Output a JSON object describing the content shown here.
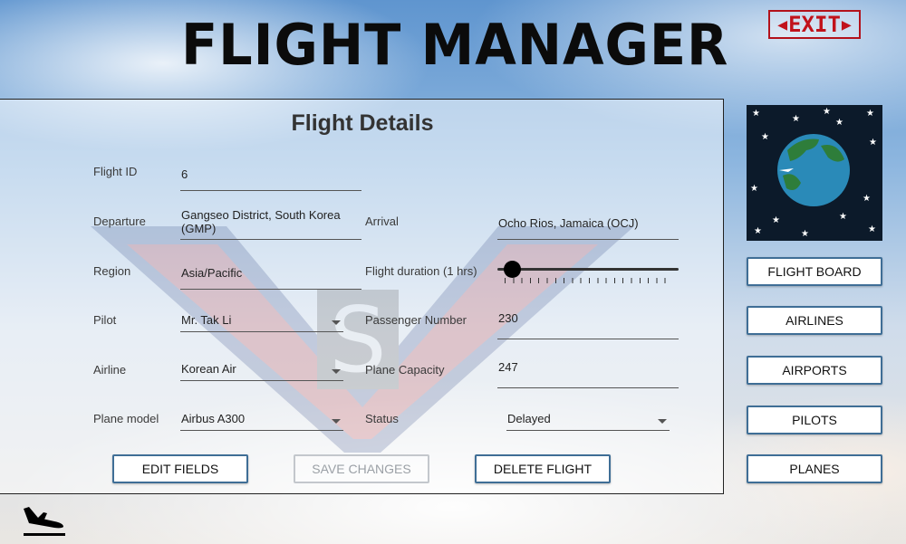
{
  "app": {
    "title": "FLIGHT MANAGER",
    "exit_label": "EXIT"
  },
  "form": {
    "title": "Flight Details",
    "flight_id": {
      "label": "Flight ID",
      "value": "6"
    },
    "departure": {
      "label": "Departure",
      "value": "Gangseo District, South Korea (GMP)"
    },
    "arrival": {
      "label": "Arrival",
      "value": "Ocho Rios, Jamaica (OCJ)"
    },
    "region": {
      "label": "Region",
      "value": "Asia/Pacific"
    },
    "duration": {
      "label": "Flight duration (1 hrs)",
      "value_hrs": 1
    },
    "pilot": {
      "label": "Pilot",
      "value": "Mr. Tak Li"
    },
    "passengers": {
      "label": "Passenger Number",
      "value": "230"
    },
    "airline": {
      "label": "Airline",
      "value": "Korean Air"
    },
    "capacity": {
      "label": "Plane Capacity",
      "value": "247"
    },
    "plane_model": {
      "label": "Plane model",
      "value": "Airbus A300"
    },
    "status": {
      "label": "Status",
      "value": "Delayed"
    }
  },
  "actions": {
    "edit": "EDIT FIELDS",
    "save": "SAVE CHANGES",
    "delete": "DELETE FLIGHT"
  },
  "nav": {
    "flight_board": "FLIGHT BOARD",
    "airlines": "AIRLINES",
    "airports": "AIRPORTS",
    "pilots": "PILOTS",
    "planes": "PLANES"
  },
  "icons": {
    "globe": "globe-icon",
    "landing": "plane-landing-icon",
    "exit_arrows": "triangle-arrow-icon"
  },
  "colors": {
    "exit_red": "#c1121b",
    "button_border": "#3f6e96",
    "disabled_text": "#9ba0a6"
  }
}
